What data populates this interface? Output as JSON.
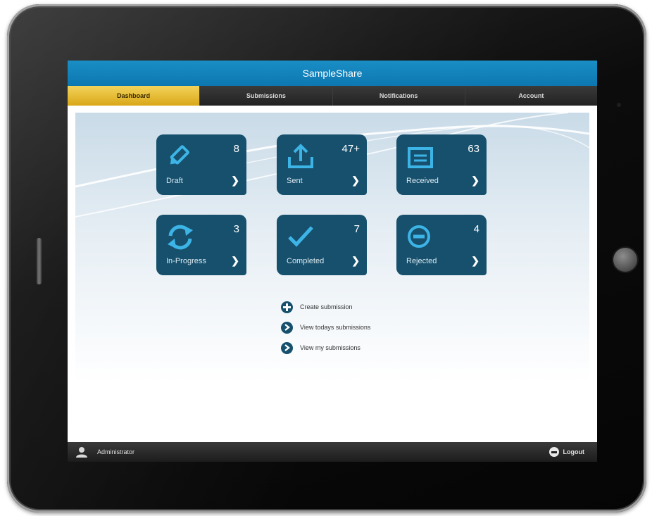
{
  "app": {
    "title": "SampleShare"
  },
  "nav": {
    "tabs": [
      {
        "label": "Dashboard",
        "active": true
      },
      {
        "label": "Submissions",
        "active": false
      },
      {
        "label": "Notifications",
        "active": false
      },
      {
        "label": "Account",
        "active": false
      }
    ]
  },
  "tiles": [
    {
      "label": "Draft",
      "count": "8",
      "icon": "pencil-icon"
    },
    {
      "label": "Sent",
      "count": "47+",
      "icon": "upload-icon"
    },
    {
      "label": "Received",
      "count": "63",
      "icon": "inbox-icon"
    },
    {
      "label": "In-Progress",
      "count": "3",
      "icon": "refresh-icon"
    },
    {
      "label": "Completed",
      "count": "7",
      "icon": "checkmark-icon"
    },
    {
      "label": "Rejected",
      "count": "4",
      "icon": "minus-circle-icon"
    }
  ],
  "actions": [
    {
      "label": "Create submission",
      "icon": "plus-circle-icon"
    },
    {
      "label": "View todays submissions",
      "icon": "chevron-circle-icon"
    },
    {
      "label": "View my submissions",
      "icon": "chevron-circle-icon"
    }
  ],
  "footer": {
    "user": "Administrator",
    "logout": "Logout"
  },
  "colors": {
    "titlebar": "#1a8ec6",
    "active_tab": "#e8bd2c",
    "tile": "#16506d",
    "icon_accent": "#3db4e6"
  }
}
